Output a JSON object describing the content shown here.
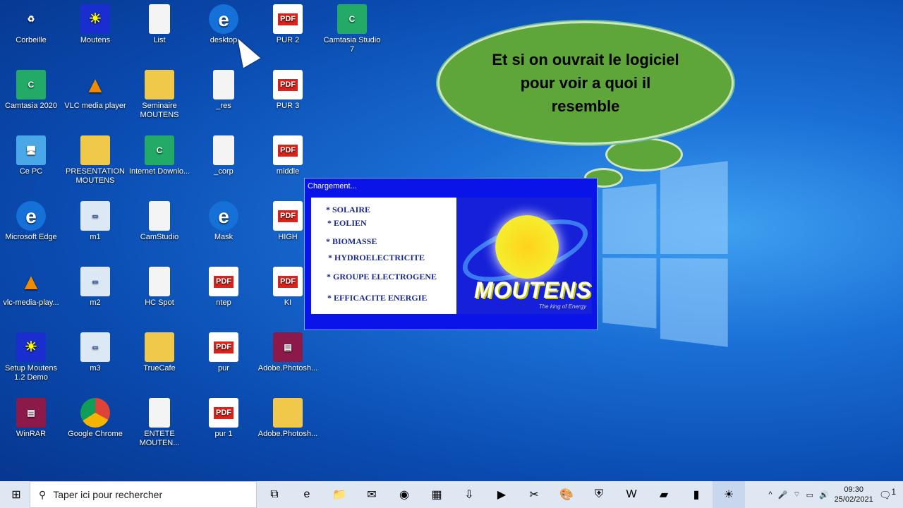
{
  "desktop": {
    "columns": [
      [
        {
          "label": "Corbeille",
          "type": "bin"
        },
        {
          "label": "Camtasia 2020",
          "type": "app"
        },
        {
          "label": "Ce PC",
          "type": "pc"
        },
        {
          "label": "Microsoft Edge",
          "type": "edge"
        },
        {
          "label": "vlc-media-play...",
          "type": "vlc"
        },
        {
          "label": "Setup Moutens 1.2 Demo",
          "type": "mout"
        },
        {
          "label": "WinRAR",
          "type": "rar"
        }
      ],
      [
        {
          "label": "Moutens",
          "type": "mout"
        },
        {
          "label": "VLC media player",
          "type": "vlc"
        },
        {
          "label": "PRESENTATION MOUTENS",
          "type": "folder"
        },
        {
          "label": "m1",
          "type": "win"
        },
        {
          "label": "m2",
          "type": "win"
        },
        {
          "label": "m3",
          "type": "win"
        },
        {
          "label": "Google Chrome",
          "type": "chrome"
        }
      ],
      [
        {
          "label": "List",
          "type": "file"
        },
        {
          "label": "Seminaire MOUTENS",
          "type": "folder"
        },
        {
          "label": "Internet Downlo...",
          "type": "app"
        },
        {
          "label": "CamStudio",
          "type": "file"
        },
        {
          "label": "HC Spot",
          "type": "file"
        },
        {
          "label": "TrueCafe",
          "type": "folder"
        },
        {
          "label": "ENTETE MOUTEN...",
          "type": "file"
        }
      ],
      [
        {
          "label": "desktop",
          "type": "edge"
        },
        {
          "label": "_res",
          "type": "file"
        },
        {
          "label": "_corp",
          "type": "file"
        },
        {
          "label": "Mask",
          "type": "edge"
        },
        {
          "label": "ntep",
          "type": "pdf"
        },
        {
          "label": "pur",
          "type": "pdf"
        },
        {
          "label": "pur 1",
          "type": "pdf"
        }
      ],
      [
        {
          "label": "PUR 2",
          "type": "pdf"
        },
        {
          "label": "PUR 3",
          "type": "pdf"
        },
        {
          "label": "middle",
          "type": "pdf"
        },
        {
          "label": "HIGH",
          "type": "pdf"
        },
        {
          "label": "KI",
          "type": "pdf"
        },
        {
          "label": "Adobe.Photosh...",
          "type": "rar"
        },
        {
          "label": "Adobe.Photosh...",
          "type": "folder"
        }
      ],
      [
        {
          "label": "Camtasia Studio 7",
          "type": "app"
        }
      ]
    ]
  },
  "callout": {
    "text": "Et si on ouvrait le logiciel pour voir a quoi il resemble"
  },
  "splash": {
    "title": "Chargement...",
    "items": [
      "* SOLAIRE",
      "* EOLIEN",
      "* BIOMASSE",
      "* HYDROELECTRICITE",
      "* GROUPE ELECTROGENE",
      "* EFFICACITE ENERGIE"
    ],
    "brand": "MOUTENS",
    "tagline": "The king of Energy"
  },
  "taskbar": {
    "search_placeholder": "Taper ici pour rechercher",
    "apps": [
      "task-view",
      "edge",
      "file-explorer",
      "mail",
      "chrome",
      "calculator",
      "internet-download-manager",
      "media",
      "snipping",
      "paint",
      "defender",
      "word",
      "camtasia",
      "camstudio",
      "moutens"
    ],
    "time": "09:30",
    "date": "25/02/2021",
    "notifications": "1"
  }
}
